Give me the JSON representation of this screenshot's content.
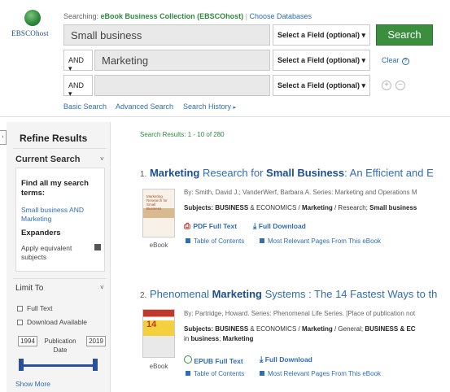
{
  "header": {
    "logo_text": "EBSCOhost",
    "searching_label": "Searching:",
    "collection": "eBook Business Collection (EBSCOhost)",
    "separator": "|",
    "choose_databases": "Choose Databases",
    "rows": [
      {
        "bool": "",
        "value": "Small business",
        "field": "Select a Field (optional)"
      },
      {
        "bool": "AND",
        "value": "Marketing",
        "field": "Select a Field (optional)"
      },
      {
        "bool": "AND",
        "value": "",
        "field": "Select a Field (optional)"
      }
    ],
    "search_button": "Search",
    "clear": "Clear",
    "add_icon": "+",
    "remove_icon": "−",
    "links": {
      "basic": "Basic Search",
      "advanced": "Advanced Search",
      "history": "Search History"
    }
  },
  "sidebar": {
    "title": "Refine Results",
    "current_search": "Current Search",
    "find_terms": "Find all my search terms:",
    "query": "Small business AND Marketing",
    "expanders": "Expanders",
    "apply_equivalent": "Apply equivalent subjects",
    "limit_to": "Limit To",
    "full_text": "Full Text",
    "download_available": "Download Available",
    "year_from": "1994",
    "year_to": "2019",
    "publication_date": "Publication Date",
    "show_more": "Show More"
  },
  "results": {
    "count": "Search Results: 1 - 10 of 280",
    "items": [
      {
        "num": "1.",
        "t1": "Marketing",
        "t2": " Research for ",
        "t3": "Small Business",
        "t4": ": An Efficient and E",
        "meta": "By: Smith, David J.; VanderWerf, Barbara A. Series: Marketing and Operations M",
        "subjects_label": "Subjects:",
        "subjects_a": "BUSINESS",
        "subjects_b": " & ECONOMICS / ",
        "subjects_c": "Marketing",
        "subjects_d": " / Research; ",
        "subjects_e": "Small business",
        "type": "eBook",
        "fulltext": "PDF Full Text",
        "download": "Full Download",
        "toc": "Table of Contents",
        "relevant": "Most Relevant Pages From This eBook"
      },
      {
        "num": "2.",
        "t1": "Phenomenal ",
        "t2": "Marketing",
        "t3": " Systems : The 14 Fastest Ways to th",
        "meta": "By: Partridge, Howard. Series: Phenomenal Life Series. [Place of publication not",
        "subjects_label": "Subjects:",
        "subjects_a": "BUSINESS",
        "subjects_b": " & ECONOMICS / ",
        "subjects_c": "Marketing",
        "subjects_d": " / General; ",
        "subjects_e": "BUSINESS & EC",
        "subjects_line2a": "in ",
        "subjects_line2b": "business",
        "subjects_line2c": "; ",
        "subjects_line2d": "Marketing",
        "type": "eBook",
        "fulltext": "EPUB Full Text",
        "download": "Full Download",
        "toc": "Table of Contents",
        "relevant": "Most Relevant Pages From This eBook"
      }
    ]
  }
}
